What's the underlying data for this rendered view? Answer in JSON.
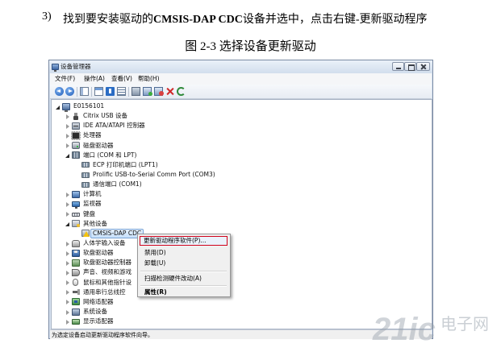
{
  "document": {
    "step_number": "3)",
    "step_text": [
      "找到要安装驱动的",
      "CMSIS-DAP CDC",
      "设备并选中，点击右键-更新驱动程序"
    ],
    "figure_caption": "图 2-3 选择设备更新驱动"
  },
  "window": {
    "title": "设备管理器",
    "title_icon": "device-manager-icon",
    "menu": [
      "文件(F)",
      "操作(A)",
      "查看(V)",
      "帮助(H)"
    ],
    "toolbar_icons": [
      "back-icon",
      "forward-icon",
      "console-tree-icon",
      "properties-icon",
      "help-icon",
      "view-icon",
      "scan-hardware-icon",
      "update-driver-icon",
      "disable-icon",
      "uninstall-icon",
      "refresh-icon"
    ],
    "tree": {
      "label": "E0156101",
      "icon": "computer-icon",
      "expanded": true,
      "children": [
        {
          "label": "Citrix USB 设备",
          "icon": "usb-device-icon"
        },
        {
          "label": "IDE ATA/ATAPI 控制器",
          "icon": "ide-controller-icon"
        },
        {
          "label": "处理器",
          "icon": "processor-icon"
        },
        {
          "label": "磁盘驱动器",
          "icon": "disk-drive-icon"
        },
        {
          "label": "端口 (COM 和 LPT)",
          "icon": "port-icon",
          "expanded": true,
          "children": [
            {
              "label": "ECP 打印机端口 (LPT1)",
              "icon": "port-icon"
            },
            {
              "label": "Prolific USB-to-Serial Comm Port (COM3)",
              "icon": "port-icon"
            },
            {
              "label": "通信端口 (COM1)",
              "icon": "port-icon"
            }
          ]
        },
        {
          "label": "计算机",
          "icon": "computer-icon"
        },
        {
          "label": "监视器",
          "icon": "monitor-icon"
        },
        {
          "label": "键盘",
          "icon": "keyboard-icon"
        },
        {
          "label": "其他设备",
          "icon": "other-devices-icon",
          "expanded": true,
          "children": [
            {
              "label": "CMSIS-DAP CDC",
              "icon": "warning-device-icon",
              "selected": true
            }
          ]
        },
        {
          "label": "人体学输入设备",
          "icon": "hid-icon"
        },
        {
          "label": "软盘驱动器",
          "icon": "floppy-drive-icon"
        },
        {
          "label": "软盘驱动器控制器",
          "icon": "floppy-controller-icon"
        },
        {
          "label": "声音、视频和游戏",
          "icon": "sound-icon"
        },
        {
          "label": "鼠标和其他指针设",
          "icon": "mouse-icon"
        },
        {
          "label": "通用串行总线控",
          "icon": "usb-controller-icon"
        },
        {
          "label": "网络适配器",
          "icon": "network-adapter-icon"
        },
        {
          "label": "系统设备",
          "icon": "system-device-icon"
        },
        {
          "label": "显示适配器",
          "icon": "display-adapter-icon"
        }
      ]
    },
    "status": "为选定设备启动更新驱动程序软件向导。"
  },
  "context_menu": {
    "items": [
      "更新驱动程序软件(P)...",
      "禁用(D)",
      "卸载(U)",
      "扫描检测硬件改动(A)",
      "属性(R)"
    ],
    "highlighted_item": "更新驱动程序软件(P)...",
    "default_item": "属性(R)"
  },
  "watermark": {
    "logo_text": "21ic",
    "site_name": "电子网"
  },
  "colors": {
    "highlight_box": "#d0021b",
    "selection_fill": "#c7e0fb",
    "selection_border": "#7aa3d4",
    "title_bar": "#d2deed",
    "window_frame": "#7b8ba4"
  }
}
